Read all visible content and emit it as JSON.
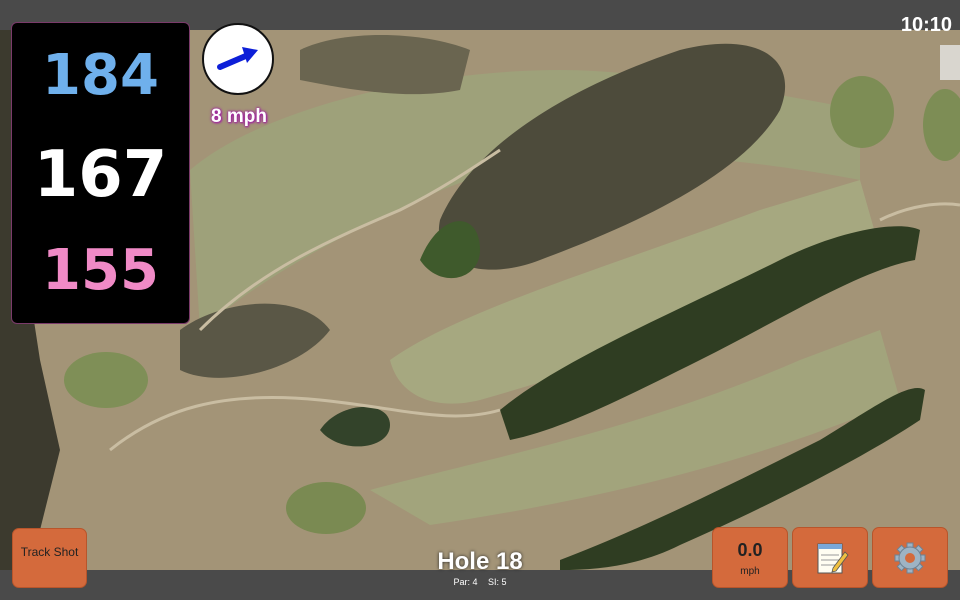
{
  "status": {
    "time": "10:10"
  },
  "yardage": {
    "back": "184",
    "middle": "167",
    "front": "155"
  },
  "wind": {
    "speed": "8 mph",
    "icon": "wind-arrow-icon"
  },
  "buttons": {
    "track_shot": "Track Shot",
    "speed_value": "0.0",
    "speed_unit": "mph",
    "notes_icon": "notepad-icon",
    "settings_icon": "gear-icon"
  },
  "hole": {
    "title": "Hole 18",
    "par": "Par: 4",
    "si": "SI: 5"
  },
  "colors": {
    "button": "#d46a3c",
    "back": "#6fb0ec",
    "front": "#f08ac6"
  }
}
